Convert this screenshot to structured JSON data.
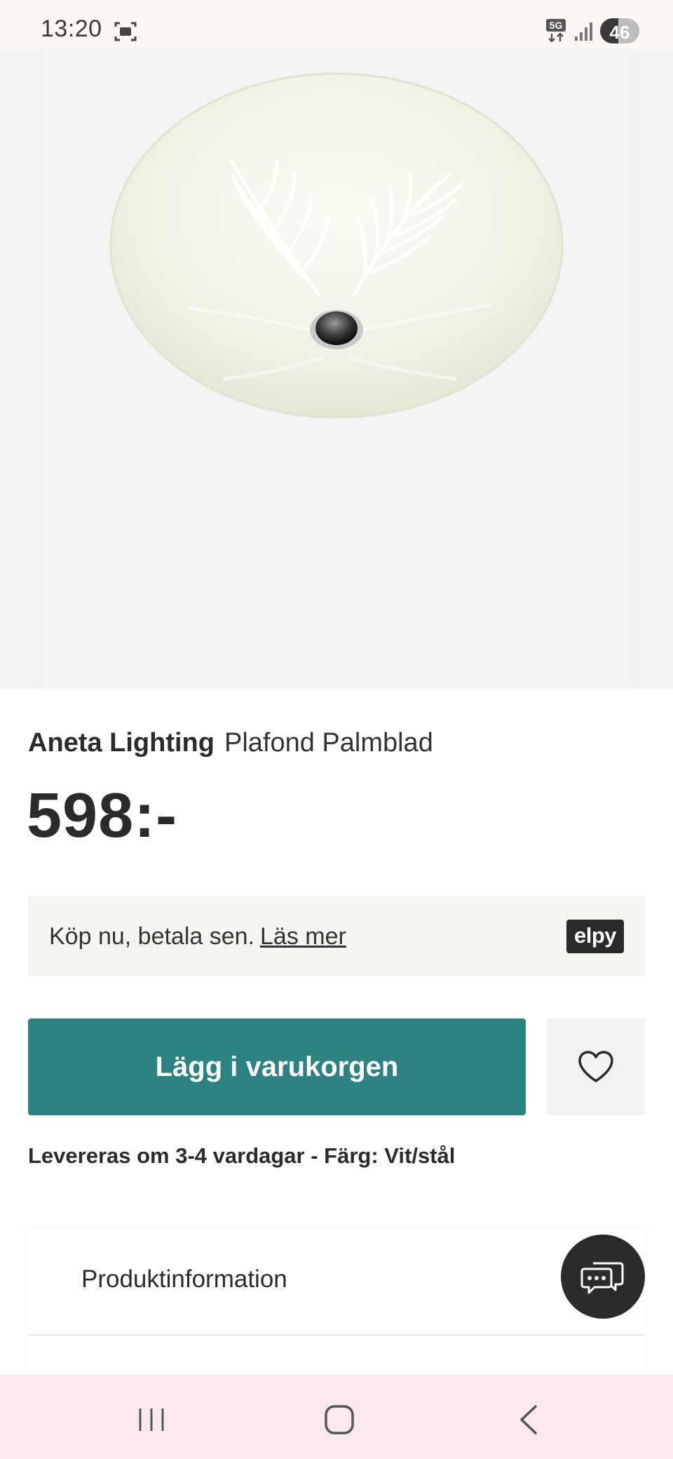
{
  "status_bar": {
    "time": "13:20",
    "network_badge": "5G",
    "battery_level": "46",
    "icons": [
      "screenshot-icon",
      "5g-icon",
      "signal-icon",
      "battery-icon"
    ]
  },
  "product": {
    "brand": "Aneta Lighting",
    "name": "Plafond Palmblad",
    "price": "598:-"
  },
  "pay_later": {
    "text": "Köp nu, betala sen.",
    "link": "Läs mer",
    "logo": "elpy"
  },
  "actions": {
    "add_to_cart": "Lägg i varukorgen",
    "wishlist_icon": "heart-icon"
  },
  "delivery": {
    "text": "Levereras om 3-4 vardagar - Färg: Vit/stål"
  },
  "accordion": {
    "items": [
      {
        "label": "Produktinformation"
      }
    ]
  },
  "chat": {
    "icon": "chat-icon"
  },
  "nav_bar": {
    "icons": [
      "recent-apps-icon",
      "home-icon",
      "back-icon"
    ]
  },
  "colors": {
    "accent": "#2b8280",
    "text": "#2b2b2b",
    "pay_later_bg": "#f6f4f1",
    "image_bg": "#f2f2f2",
    "nav_bg": "#f9e8ec"
  }
}
